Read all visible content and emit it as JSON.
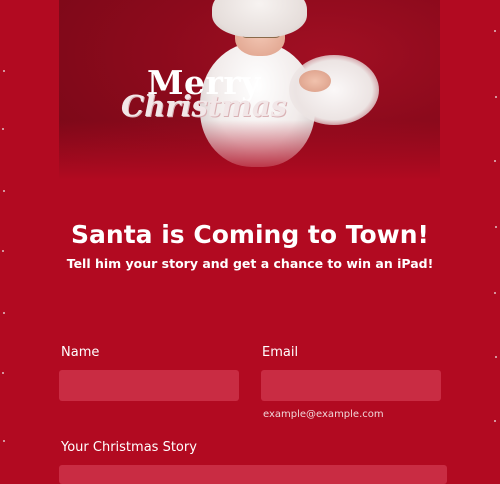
{
  "hero": {
    "merry_text": "Merry",
    "christmas_text": "Christmas"
  },
  "header": {
    "title": "Santa is Coming to Town!",
    "subtitle": "Tell him your story and get a chance to win an iPad!"
  },
  "form": {
    "name": {
      "label": "Name",
      "value": "",
      "placeholder": ""
    },
    "email": {
      "label": "Email",
      "value": "",
      "placeholder": "",
      "hint": "example@example.com"
    },
    "story": {
      "label": "Your Christmas Story",
      "value": "",
      "placeholder": ""
    }
  },
  "colors": {
    "background": "#b20a21",
    "field_background": "#c92c43",
    "text": "#ffffff"
  }
}
